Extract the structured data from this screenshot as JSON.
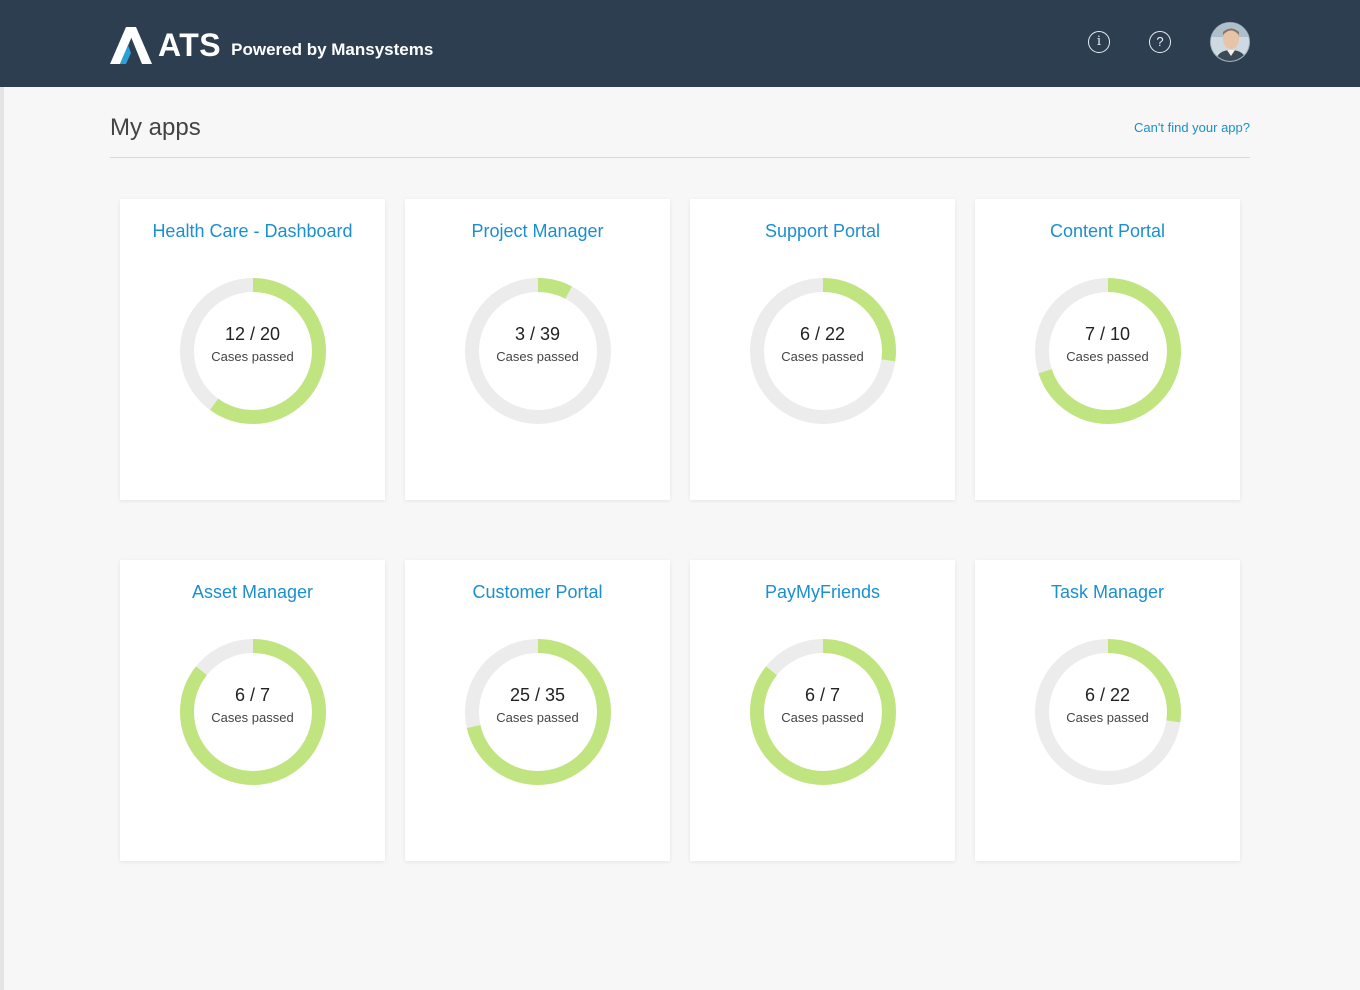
{
  "header": {
    "logo_text": "ATS",
    "tagline": "Powered by Mansystems",
    "info_icon": "info-icon",
    "help_icon": "help-icon"
  },
  "page": {
    "title": "My apps",
    "help_link": "Can't find your app?"
  },
  "colors": {
    "header_bg": "#2d3e50",
    "accent_link": "#1b8fcf",
    "progress": "#c0e580",
    "track": "#ececec"
  },
  "caption": "Cases passed",
  "apps": [
    {
      "name": "Health Care - Dashboard",
      "passed": 12,
      "total": 20,
      "label": "12 / 20"
    },
    {
      "name": "Project Manager",
      "passed": 3,
      "total": 39,
      "label": "3 / 39"
    },
    {
      "name": "Support Portal",
      "passed": 6,
      "total": 22,
      "label": "6 / 22"
    },
    {
      "name": "Content Portal",
      "passed": 7,
      "total": 10,
      "label": "7 / 10"
    },
    {
      "name": "Asset Manager",
      "passed": 6,
      "total": 7,
      "label": "6 / 7"
    },
    {
      "name": "Customer Portal",
      "passed": 25,
      "total": 35,
      "label": "25 / 35"
    },
    {
      "name": "PayMyFriends",
      "passed": 6,
      "total": 7,
      "label": "6 / 7"
    },
    {
      "name": "Task Manager",
      "passed": 6,
      "total": 22,
      "label": "6 / 22"
    }
  ]
}
